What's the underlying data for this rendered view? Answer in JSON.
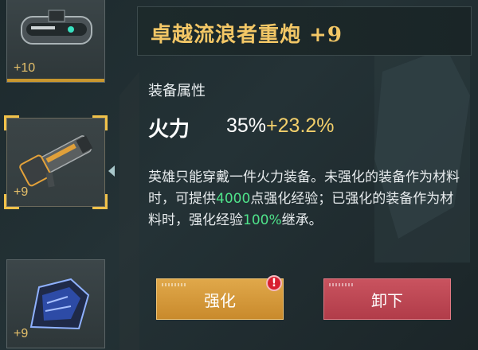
{
  "inventory": {
    "items": [
      {
        "name": "visor-device",
        "level": "+10"
      },
      {
        "name": "heavy-cannon",
        "level": "+9"
      },
      {
        "name": "blue-armor",
        "level": "+9"
      }
    ]
  },
  "detail": {
    "title": "卓越流浪者重炮 +9",
    "attributes_label": "装备属性",
    "stat_name": "火力",
    "stat_base": "35%",
    "stat_bonus": "+23.2%",
    "desc_part1": "英雄只能穿戴一件火力装备。未强化的装备作为材料时，可提供",
    "desc_exp": "4000",
    "desc_part2": "点强化经验；已强化的装备作为材料时，强化经验",
    "desc_inherit": "100%",
    "desc_part3": "继承。"
  },
  "buttons": {
    "enhance_label": "强化",
    "alert_mark": "!",
    "unequip_label": "卸下"
  },
  "colors": {
    "title_gold": "#f3c766",
    "highlight_green": "#4fe38a",
    "enhance_orange": "#d89a3a",
    "unequip_red": "#be4653"
  }
}
